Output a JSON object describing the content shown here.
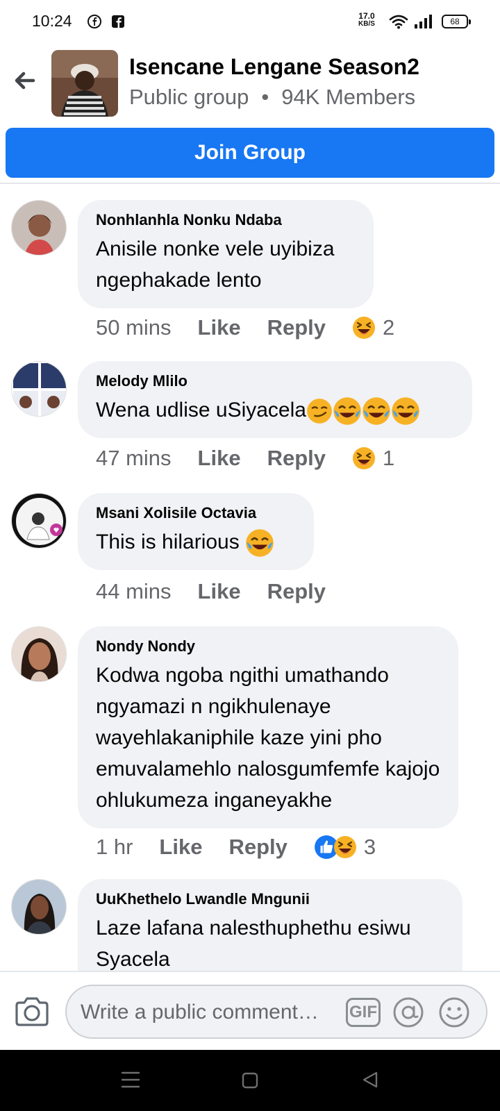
{
  "status_bar": {
    "time": "10:24",
    "speed_value": "17.0",
    "speed_unit": "KB/S",
    "battery": "68"
  },
  "header": {
    "group_name": "Isencane Lengane Season2",
    "privacy": "Public group",
    "separator": "•",
    "members": "94K Members"
  },
  "join_button": "Join Group",
  "comments": [
    {
      "name": "Nonhlanhla Nonku Ndaba",
      "text": "Anisile nonke vele uyibiza ngephakade lento",
      "time": "50 mins",
      "like": "Like",
      "reply": "Reply",
      "reaction_count": "2"
    },
    {
      "name": "Melody Mlilo",
      "text": "Wena udlise uSiyacela",
      "time": "47 mins",
      "like": "Like",
      "reply": "Reply",
      "reaction_count": "1"
    },
    {
      "name": "Msani Xolisile Octavia",
      "text": "This is hilarious",
      "time": "44 mins",
      "like": "Like",
      "reply": "Reply"
    },
    {
      "name": "Nondy Nondy",
      "text": "Kodwa ngoba ngithi umathando ngyamazi n ngikhulenaye wayehlakaniphile  kaze yini pho emuvalamehlo  nalosgumfemfe kajojo  ohlukumeza  inganeyakhe",
      "time": "1 hr",
      "like": "Like",
      "reply": "Reply",
      "reaction_count": "3"
    },
    {
      "name": "UuKhethelo Lwandle Mngunii",
      "text": "Laze lafana nalesthuphethu esiwu Syacela"
    }
  ],
  "composer": {
    "placeholder": "Write a public comment…",
    "gif_label": "GIF"
  },
  "icons": {
    "back": "arrow-left-icon",
    "camera": "camera-icon",
    "at": "at-sign-icon",
    "emoji": "smiley-icon",
    "laugh_reaction": "laughing-squint-icon",
    "like_reaction": "thumbs-up-icon"
  },
  "colors": {
    "accent": "#1877f2",
    "bubble": "#f0f2f5",
    "secondary_text": "#65676b"
  }
}
